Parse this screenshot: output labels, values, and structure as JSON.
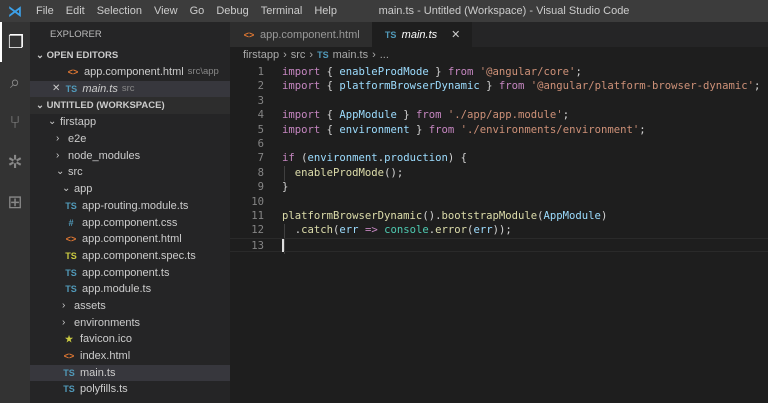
{
  "titlebar": {
    "menus": [
      "File",
      "Edit",
      "Selection",
      "View",
      "Go",
      "Debug",
      "Terminal",
      "Help"
    ],
    "title": "main.ts - Untitled (Workspace) - Visual Studio Code"
  },
  "activity": [
    "files-icon",
    "search-icon",
    "source-control-icon",
    "debug-icon",
    "extensions-icon"
  ],
  "sidebar": {
    "title": "EXPLORER",
    "open_editors": {
      "label": "OPEN EDITORS",
      "items": [
        {
          "name": "app.component.html",
          "desc": "src\\app",
          "icon": "<>"
        },
        {
          "name": "main.ts",
          "desc": "src",
          "icon": "TS"
        }
      ]
    },
    "workspace": {
      "label": "UNTITLED (WORKSPACE)",
      "tree": [
        {
          "name": "firstapp",
          "chev": "⌄",
          "lvl": 1
        },
        {
          "name": "e2e",
          "chev": "›",
          "lvl": 2
        },
        {
          "name": "node_modules",
          "chev": "›",
          "lvl": 2
        },
        {
          "name": "src",
          "chev": "⌄",
          "lvl": 2
        },
        {
          "name": "app",
          "chev": "⌄",
          "lvl": 3
        },
        {
          "name": "app-routing.module.ts",
          "icon": "TS",
          "lvl": 4
        },
        {
          "name": "app.component.css",
          "icon": "#",
          "lvl": 4
        },
        {
          "name": "app.component.html",
          "icon": "<>",
          "lvl": 4
        },
        {
          "name": "app.component.spec.ts",
          "icon": "TS",
          "lvl": 4,
          "spec": true
        },
        {
          "name": "app.component.ts",
          "icon": "TS",
          "lvl": 4
        },
        {
          "name": "app.module.ts",
          "icon": "TS",
          "lvl": 4
        },
        {
          "name": "assets",
          "chev": "›",
          "lvl": 3
        },
        {
          "name": "environments",
          "chev": "›",
          "lvl": 3
        },
        {
          "name": "favicon.ico",
          "icon": "★",
          "lvl": 3,
          "fav": true
        },
        {
          "name": "index.html",
          "icon": "<>",
          "lvl": 3
        },
        {
          "name": "main.ts",
          "icon": "TS",
          "lvl": 3,
          "selected": true
        },
        {
          "name": "polyfills.ts",
          "icon": "TS",
          "lvl": 3
        }
      ]
    }
  },
  "tabs": [
    {
      "label": "app.component.html",
      "icon": "<>"
    },
    {
      "label": "main.ts",
      "icon": "TS",
      "active": true,
      "close": "✕"
    }
  ],
  "breadcrumb": {
    "parts": [
      "firstapp",
      "src",
      "main.ts",
      "..."
    ],
    "sep": "›",
    "ts_icon": "TS"
  },
  "code": [
    [
      [
        "import",
        "kw"
      ],
      [
        " { ",
        "p"
      ],
      [
        "enableProdMode",
        "id"
      ],
      [
        " } ",
        "p"
      ],
      [
        "from",
        "kw"
      ],
      [
        " ",
        "p"
      ],
      [
        "'@angular/core'",
        "st"
      ],
      [
        ";",
        "p"
      ]
    ],
    [
      [
        "import",
        "kw"
      ],
      [
        " { ",
        "p"
      ],
      [
        "platformBrowserDynamic",
        "id"
      ],
      [
        " } ",
        "p"
      ],
      [
        "from",
        "kw"
      ],
      [
        " ",
        "p"
      ],
      [
        "'@angular/platform-browser-dynamic'",
        "st"
      ],
      [
        ";",
        "p"
      ]
    ],
    [],
    [
      [
        "import",
        "kw"
      ],
      [
        " { ",
        "p"
      ],
      [
        "AppModule",
        "id"
      ],
      [
        " } ",
        "p"
      ],
      [
        "from",
        "kw"
      ],
      [
        " ",
        "p"
      ],
      [
        "'./app/app.module'",
        "st"
      ],
      [
        ";",
        "p"
      ]
    ],
    [
      [
        "import",
        "kw"
      ],
      [
        " { ",
        "p"
      ],
      [
        "environment",
        "id"
      ],
      [
        " } ",
        "p"
      ],
      [
        "from",
        "kw"
      ],
      [
        " ",
        "p"
      ],
      [
        "'./environments/environment'",
        "st"
      ],
      [
        ";",
        "p"
      ]
    ],
    [],
    [
      [
        "if",
        "kw"
      ],
      [
        " (",
        "p"
      ],
      [
        "environment",
        "id"
      ],
      [
        ".",
        "p"
      ],
      [
        "production",
        "id"
      ],
      [
        ") {",
        "p"
      ]
    ],
    [
      [
        "  ",
        "p"
      ],
      [
        "enableProdMode",
        "fn"
      ],
      [
        "();",
        "p"
      ]
    ],
    [
      [
        "}",
        "p"
      ]
    ],
    [],
    [
      [
        "platformBrowserDynamic",
        "fn"
      ],
      [
        "().",
        "p"
      ],
      [
        "bootstrapModule",
        "fn"
      ],
      [
        "(",
        "p"
      ],
      [
        "AppModule",
        "id"
      ],
      [
        ")",
        "p"
      ]
    ],
    [
      [
        "  .",
        "p"
      ],
      [
        "catch",
        "fn"
      ],
      [
        "(",
        "p"
      ],
      [
        "err",
        "id"
      ],
      [
        " ",
        "p"
      ],
      [
        "=>",
        "kw"
      ],
      [
        " ",
        "p"
      ],
      [
        "console",
        "cl"
      ],
      [
        ".",
        "p"
      ],
      [
        "error",
        "fn"
      ],
      [
        "(",
        "p"
      ],
      [
        "err",
        "id"
      ],
      [
        "));",
        "p"
      ]
    ],
    []
  ]
}
